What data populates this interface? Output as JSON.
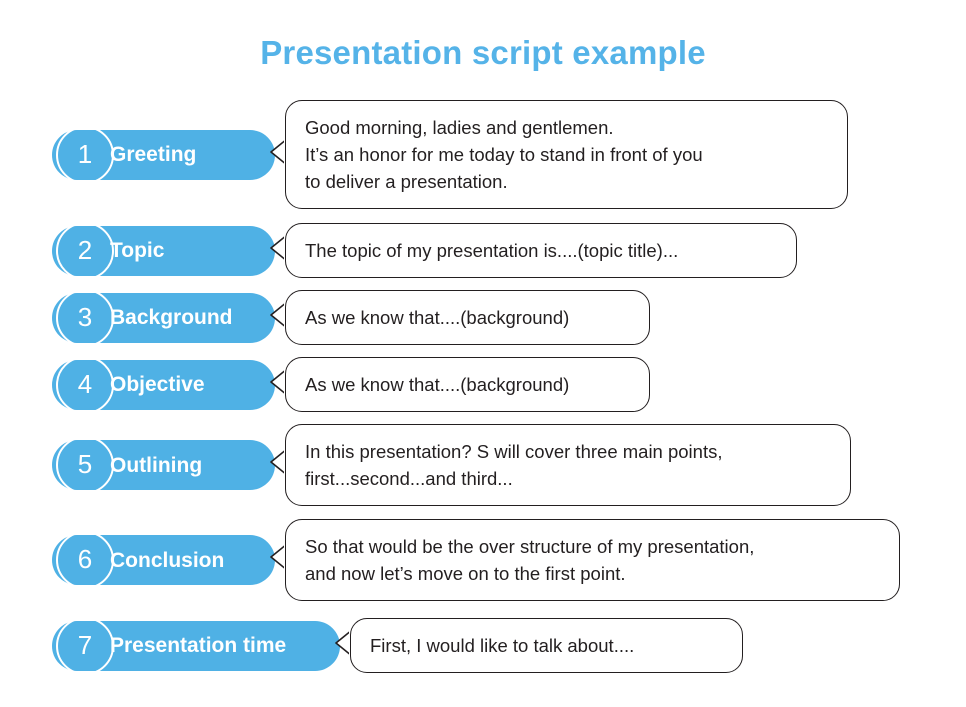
{
  "slide": {
    "title": "Presentation script example",
    "title_color": "#55b3e8",
    "accent_color": "#4fb1e5",
    "bubble_border_color": "#231f20",
    "text_color": "#231f20",
    "background_color": "#ffffff"
  },
  "steps": [
    {
      "number": "1",
      "label": "Greeting",
      "lines": [
        "Good morning, ladies and gentlemen.",
        "It’s an honor for me today to stand in front of you",
        "to deliver a presentation."
      ]
    },
    {
      "number": "2",
      "label": "Topic",
      "lines": [
        "The topic of my presentation is....(topic title)..."
      ]
    },
    {
      "number": "3",
      "label": "Background",
      "lines": [
        "As we know that....(background)"
      ]
    },
    {
      "number": "4",
      "label": "Objective",
      "lines": [
        "As we know that....(background)"
      ]
    },
    {
      "number": "5",
      "label": "Outlining",
      "lines": [
        "In this presentation? S will cover three main points,",
        "first...second...and third..."
      ]
    },
    {
      "number": "6",
      "label": "Conclusion",
      "lines": [
        "So that would be the over structure of my presentation,",
        "and now let’s move on to the first point."
      ]
    },
    {
      "number": "7",
      "label": "Presentation time",
      "lines": [
        "First, I would like to talk about...."
      ]
    }
  ]
}
